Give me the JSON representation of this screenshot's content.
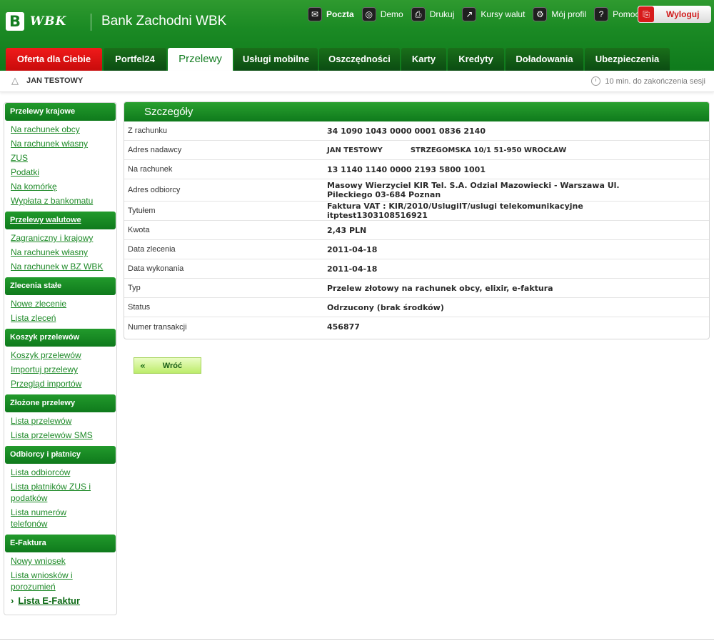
{
  "brand": {
    "logo_mark": "B",
    "logo_text": "WBK",
    "bank_name": "Bank Zachodni WBK",
    "primary_color": "#147d22",
    "offer_color": "#e31313"
  },
  "toplinks": [
    {
      "label": "Poczta",
      "icon": "mail-icon",
      "glyph": "✉"
    },
    {
      "label": "Demo",
      "icon": "demo-icon",
      "glyph": "◎"
    },
    {
      "label": "Drukuj",
      "icon": "print-icon",
      "glyph": "⎙"
    },
    {
      "label": "Kursy walut",
      "icon": "chart-icon",
      "glyph": "↗"
    },
    {
      "label": "Mój profil",
      "icon": "profile-icon",
      "glyph": "⚙"
    },
    {
      "label": "Pomoc",
      "icon": "help-icon",
      "glyph": "?"
    }
  ],
  "logout": {
    "label": "Wyloguj",
    "icon": "logout-icon",
    "glyph": "⎘"
  },
  "tabs": [
    {
      "label": "Oferta dla Ciebie"
    },
    {
      "label": "Portfel24"
    },
    {
      "label": "Przelewy"
    },
    {
      "label": "Usługi mobilne"
    },
    {
      "label": "Oszczędności"
    },
    {
      "label": "Karty"
    },
    {
      "label": "Kredyty"
    },
    {
      "label": "Doładowania"
    },
    {
      "label": "Ubezpieczenia"
    }
  ],
  "userbar": {
    "user_name": "JAN TESTOWY",
    "session_text": "10 min. do zakończenia sesji"
  },
  "sidebar": {
    "sections": [
      {
        "title": "Przelewy krajowe",
        "items": [
          "Na rachunek obcy",
          "Na rachunek własny",
          "ZUS",
          "Podatki",
          "Na komórkę",
          "Wypłata z bankomatu"
        ]
      },
      {
        "title": "Przelewy walutowe",
        "items": [
          "Zagraniczny i krajowy",
          "Na rachunek własny",
          "Na rachunek w BZ WBK"
        ]
      },
      {
        "title": "Zlecenia stałe",
        "items": [
          "Nowe zlecenie",
          "Lista zleceń"
        ]
      },
      {
        "title": "Koszyk przelewów",
        "items": [
          "Koszyk przelewów",
          "Importuj przelewy",
          "Przegląd importów"
        ]
      },
      {
        "title": "Złożone przelewy",
        "items": [
          "Lista przelewów",
          "Lista przelewów SMS"
        ]
      },
      {
        "title": "Odbiorcy i płatnicy",
        "items": [
          "Lista odbiorców",
          "Lista płatników ZUS i podatków",
          "Lista numerów telefonów"
        ]
      },
      {
        "title": "E-Faktura",
        "items": [
          "Nowy wniosek",
          "Lista wniosków i porozumień",
          "Lista E-Faktur"
        ]
      }
    ]
  },
  "details": {
    "title": "Szczegóły",
    "rows": [
      {
        "label": "Z rachunku",
        "value": "34 1090 1043 0000 0001 0836 2140"
      },
      {
        "label": "Adres nadawcy",
        "value": "JAN TESTOWY",
        "value2": "STRZEGOMSKA 10/1 51-950 WROCŁAW"
      },
      {
        "label": "Na rachunek",
        "value": "13 1140 1140 0000 2193 5800 1001"
      },
      {
        "label": "Adres odbiorcy",
        "value": "Masowy Wierzyciel KIR Tel. S.A. Odzial Mazowiecki - Warszawa Ul. Pileckiego 03-684 Poznan"
      },
      {
        "label": "Tytułem",
        "value": "Faktura VAT : KIR/2010/UslugiIT/uslugi telekomunikacyjne itptest1303108516921"
      },
      {
        "label": "Kwota",
        "value": "2,43 PLN"
      },
      {
        "label": "Data zlecenia",
        "value": "2011-04-18"
      },
      {
        "label": "Data wykonania",
        "value": "2011-04-18"
      },
      {
        "label": "Typ",
        "value": "Przelew złotowy na rachunek obcy, elixir, e-faktura"
      },
      {
        "label": "Status",
        "value": "Odrzucony (brak środków)"
      },
      {
        "label": "Numer transakcji",
        "value": "456877"
      }
    ]
  },
  "back_button": {
    "arrow": "«",
    "label": "Wróć"
  }
}
